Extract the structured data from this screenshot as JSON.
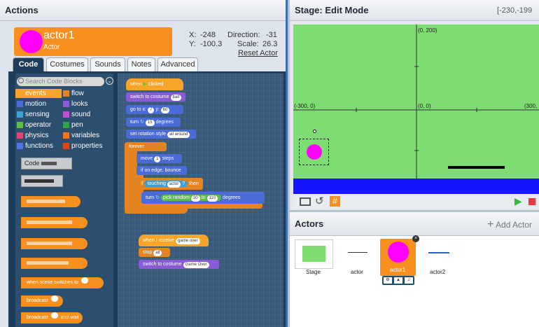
{
  "actions": {
    "title": "Actions",
    "actor": {
      "name": "actor1",
      "type": "Actor",
      "x_label": "X:",
      "x": "-248",
      "y_label": "Y:",
      "y": "-100.3",
      "dir_label": "Direction:",
      "dir": "-31",
      "scale_label": "Scale:",
      "scale": "26.3",
      "reset": "Reset Actor"
    },
    "tabs": [
      "Code",
      "Costumes",
      "Sounds",
      "Notes",
      "Advanced"
    ],
    "search_placeholder": "Search Code Blocks",
    "categories": [
      {
        "label": "events",
        "color": "#f7a52a"
      },
      {
        "label": "flow",
        "color": "#e38421"
      },
      {
        "label": "motion",
        "color": "#4b6bd6"
      },
      {
        "label": "looks",
        "color": "#8a5bd6"
      },
      {
        "label": "sensing",
        "color": "#3f9fd3"
      },
      {
        "label": "sound",
        "color": "#c04fd1"
      },
      {
        "label": "operator",
        "color": "#5bbd45"
      },
      {
        "label": "pen",
        "color": "#2fa24a"
      },
      {
        "label": "physics",
        "color": "#e0436b"
      },
      {
        "label": "variables",
        "color": "#f17523"
      },
      {
        "label": "functions",
        "color": "#4f74e3"
      },
      {
        "label": "properties",
        "color": "#d6471a"
      }
    ],
    "palette": {
      "code": "Code",
      "when_scene": "when scene switches to",
      "broadcast": "broadcast",
      "broadcast_wait": "broadcast",
      "and_wait": "and wait"
    },
    "script1": {
      "when": "when",
      "clicked": "clicked",
      "switch_costume": "switch to costume",
      "costume1": "ball",
      "goto": "go to x:",
      "gx": "7",
      "y": "y:",
      "gy": "60",
      "turn": "turn",
      "turn_val": "15",
      "degrees": "degrees",
      "rotation": "set rotation style",
      "rotation_val": "all around",
      "forever": "forever",
      "move": "move",
      "move_val": "1",
      "steps": "steps",
      "bounce": "if on edge, bounce",
      "if": "if",
      "touching": "touching",
      "touch_val": "actor",
      "q": "?",
      "then": "then",
      "turn2": "turn",
      "pick": "pick random",
      "r1": "30",
      "to": "to",
      "r2": "110",
      "degrees2": "degrees"
    },
    "script2": {
      "when_receive": "when I receive",
      "msg": "game over",
      "stop": "stop",
      "stop_val": "all",
      "switch_costume": "switch to costume",
      "costume": "Game Over"
    }
  },
  "stage": {
    "title": "Stage: Edit Mode",
    "coords": "[-230,-199",
    "labels": {
      "top": "(0, 200)",
      "left": "(-300, 0)",
      "center": "(0, 0)",
      "right": "(300,"
    }
  },
  "actors": {
    "title": "Actors",
    "add": "Add Actor",
    "items": [
      "Stage",
      "actor",
      "actor1",
      "actor2"
    ]
  },
  "colors": {
    "accent": "#f7901e",
    "panel_dark": "#1e3d5a",
    "stage_green": "#7ddc72",
    "actor_pink": "#ff00ff"
  }
}
